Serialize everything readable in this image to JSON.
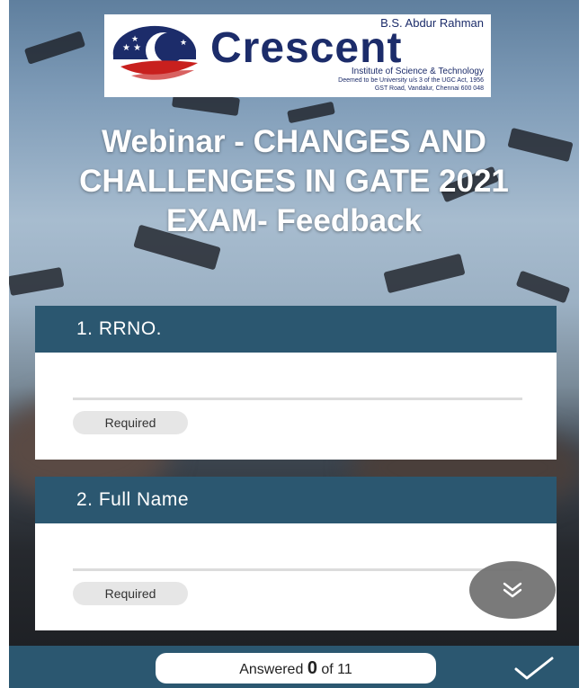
{
  "logo": {
    "top_line": "B.S. Abdur Rahman",
    "name": "Crescent",
    "line1": "Institute of Science & Technology",
    "line2": "Deemed to be University u/s 3 of the UGC Act, 1956",
    "line3": "GST Road, Vandalur, Chennai 600 048"
  },
  "form_title": "Webinar - CHANGES AND CHALLENGES IN GATE 2021 EXAM- Feedback",
  "questions": [
    {
      "label": "1. RRNO.",
      "value": "",
      "required_label": "Required"
    },
    {
      "label": "2. Full Name",
      "value": "",
      "required_label": "Required"
    }
  ],
  "progress": {
    "prefix": "Answered",
    "answered": "0",
    "suffix": "of 11"
  },
  "icons": {
    "scroll": "double-chevron-down-icon",
    "submit": "checkmark-icon"
  },
  "colors": {
    "header": "#2b5770",
    "logo_text": "#1c2c6a",
    "fab": "#6f6f6f"
  }
}
